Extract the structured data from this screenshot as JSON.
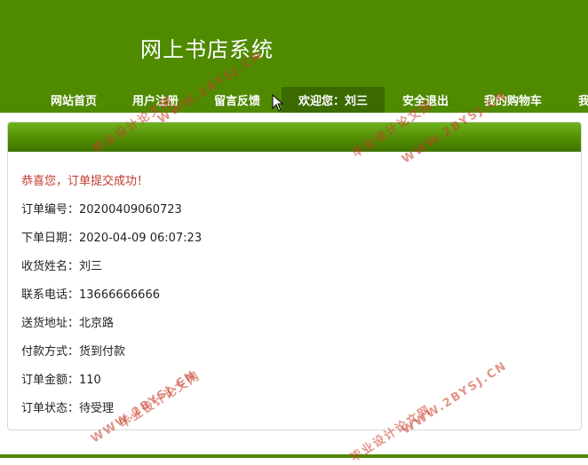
{
  "header": {
    "title": "网上书店系统",
    "nav": [
      {
        "label": "网站首页"
      },
      {
        "label": "用户注册"
      },
      {
        "label": "留言反馈"
      },
      {
        "label": "欢迎您：刘三"
      },
      {
        "label": "安全退出"
      },
      {
        "label": "我的购物车"
      },
      {
        "label": "我"
      }
    ]
  },
  "order": {
    "success_message": "恭喜您，订单提交成功！",
    "fields": [
      {
        "label": "订单编号：",
        "value": "20200409060723"
      },
      {
        "label": "下单日期：",
        "value": "2020-04-09 06:07:23"
      },
      {
        "label": "收货姓名：",
        "value": "刘三"
      },
      {
        "label": "联系电话：",
        "value": "13666666666"
      },
      {
        "label": "送货地址：",
        "value": "北京路"
      },
      {
        "label": "付款方式：",
        "value": "货到付款"
      },
      {
        "label": "订单金额：",
        "value": "110"
      },
      {
        "label": "订单状态：",
        "value": "待受理"
      }
    ]
  },
  "watermark": {
    "text_cn": "毕业设计论文网",
    "text_url": "WWW.2BYSJ.CN"
  },
  "colors": {
    "brand_green": "#4f8a00",
    "active_nav": "#3a6a00",
    "success_red": "#c0392b"
  }
}
